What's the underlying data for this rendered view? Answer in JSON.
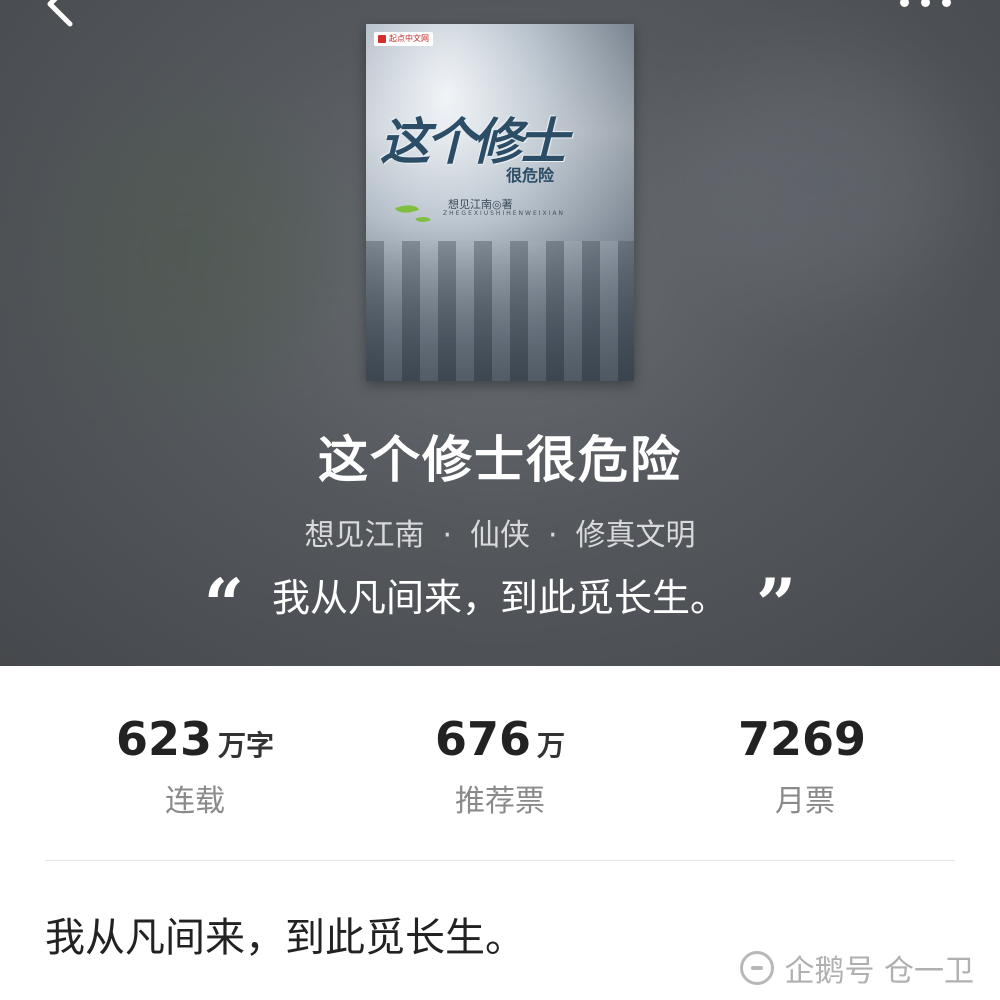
{
  "header": {
    "back_icon": "chevron-left-icon",
    "more_icon": "more-dots-icon"
  },
  "cover": {
    "publisher": "起点中文网",
    "title_art": "这个修士",
    "subtitle_art": "很危险",
    "author_line": "想见江南◎著",
    "pinyin": "ZHEGEXIUSHIHENWEIXIAN"
  },
  "book": {
    "title": "这个修士很危险",
    "author": "想见江南",
    "category": "仙侠",
    "subcategory": "修真文明",
    "separator": "·",
    "quote_open": "“",
    "quote": "我从凡间来，到此觅长生。",
    "quote_close": "”"
  },
  "stats": [
    {
      "value": "623",
      "unit": "万字",
      "label": "连载"
    },
    {
      "value": "676",
      "unit": "万",
      "label": "推荐票"
    },
    {
      "value": "7269",
      "unit": "",
      "label": "月票"
    }
  ],
  "intro": {
    "text": "我从凡间来，到此觅长生。"
  },
  "watermark": {
    "text": "企鹅号 仓一卫"
  },
  "colors": {
    "hero_bg": "#55595e",
    "publisher_red": "#d32f2f",
    "title_text": "#ffffff",
    "label_gray": "#8a8a8a"
  }
}
